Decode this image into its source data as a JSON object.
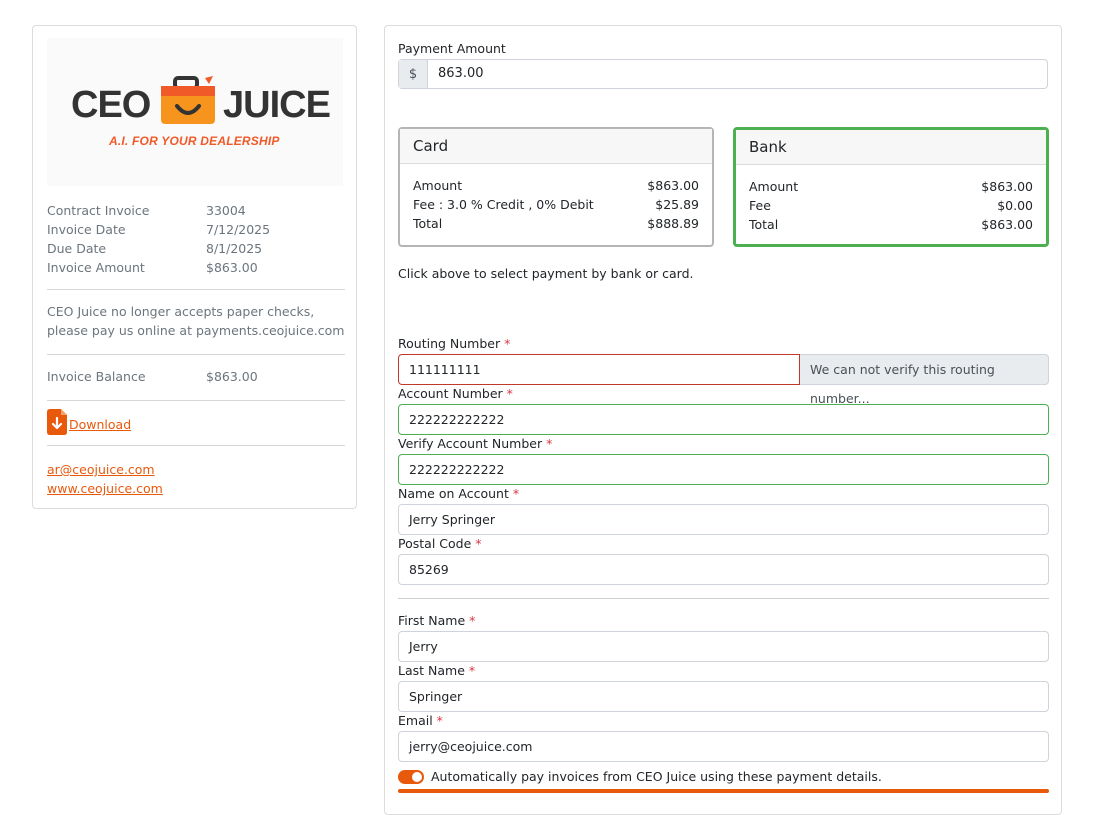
{
  "brand": {
    "logo_left": "CEO",
    "logo_right": "JUICE",
    "tagline": "A.I. FOR YOUR DEALERSHIP",
    "accent_color": "#e8590c",
    "logo_orange": "#f7941d"
  },
  "invoice": {
    "rows": [
      {
        "label": "Contract Invoice",
        "value": "33004"
      },
      {
        "label": "Invoice Date",
        "value": "7/12/2025"
      },
      {
        "label": "Due Date",
        "value": "8/1/2025"
      },
      {
        "label": "Invoice Amount",
        "value": "$863.00"
      }
    ],
    "note": "CEO Juice no longer accepts paper checks, please pay us online at payments.ceojuice.com",
    "balance_label": "Invoice Balance",
    "balance_value": "$863.00",
    "download_label": "Download",
    "email": "ar@ceojuice.com",
    "website": "www.ceojuice.com"
  },
  "payment": {
    "amount_label": "Payment Amount",
    "currency_symbol": "$",
    "amount_value": "863.00",
    "card": {
      "title": "Card",
      "rows": [
        {
          "label": "Amount",
          "value": "$863.00"
        },
        {
          "label": "Fee : 3.0 % Credit , 0% Debit",
          "value": "$25.89"
        },
        {
          "label": "Total",
          "value": "$888.89"
        }
      ]
    },
    "bank": {
      "title": "Bank",
      "selected": true,
      "selected_color": "#4caf50",
      "rows": [
        {
          "label": "Amount",
          "value": "$863.00"
        },
        {
          "label": "Fee",
          "value": "$0.00"
        },
        {
          "label": "Total",
          "value": "$863.00"
        }
      ]
    },
    "hint": "Click above to select payment by bank or card."
  },
  "form": {
    "routing_label": "Routing Number",
    "routing_value": "111111111",
    "routing_error": "We can not verify this routing number...",
    "account_label": "Account Number",
    "account_value": "222222222222",
    "verify_label": "Verify Account Number",
    "verify_value": "222222222222",
    "name_label": "Name on Account",
    "name_value": "Jerry Springer",
    "postal_label": "Postal Code",
    "postal_value": "85269",
    "first_label": "First Name",
    "first_value": "Jerry",
    "last_label": "Last Name",
    "last_value": "Springer",
    "email_label": "Email",
    "email_value": "jerry@ceojuice.com",
    "autopay_label": "Automatically pay invoices from CEO Juice using these payment details.",
    "autopay_on": true,
    "required_mark": "*"
  }
}
